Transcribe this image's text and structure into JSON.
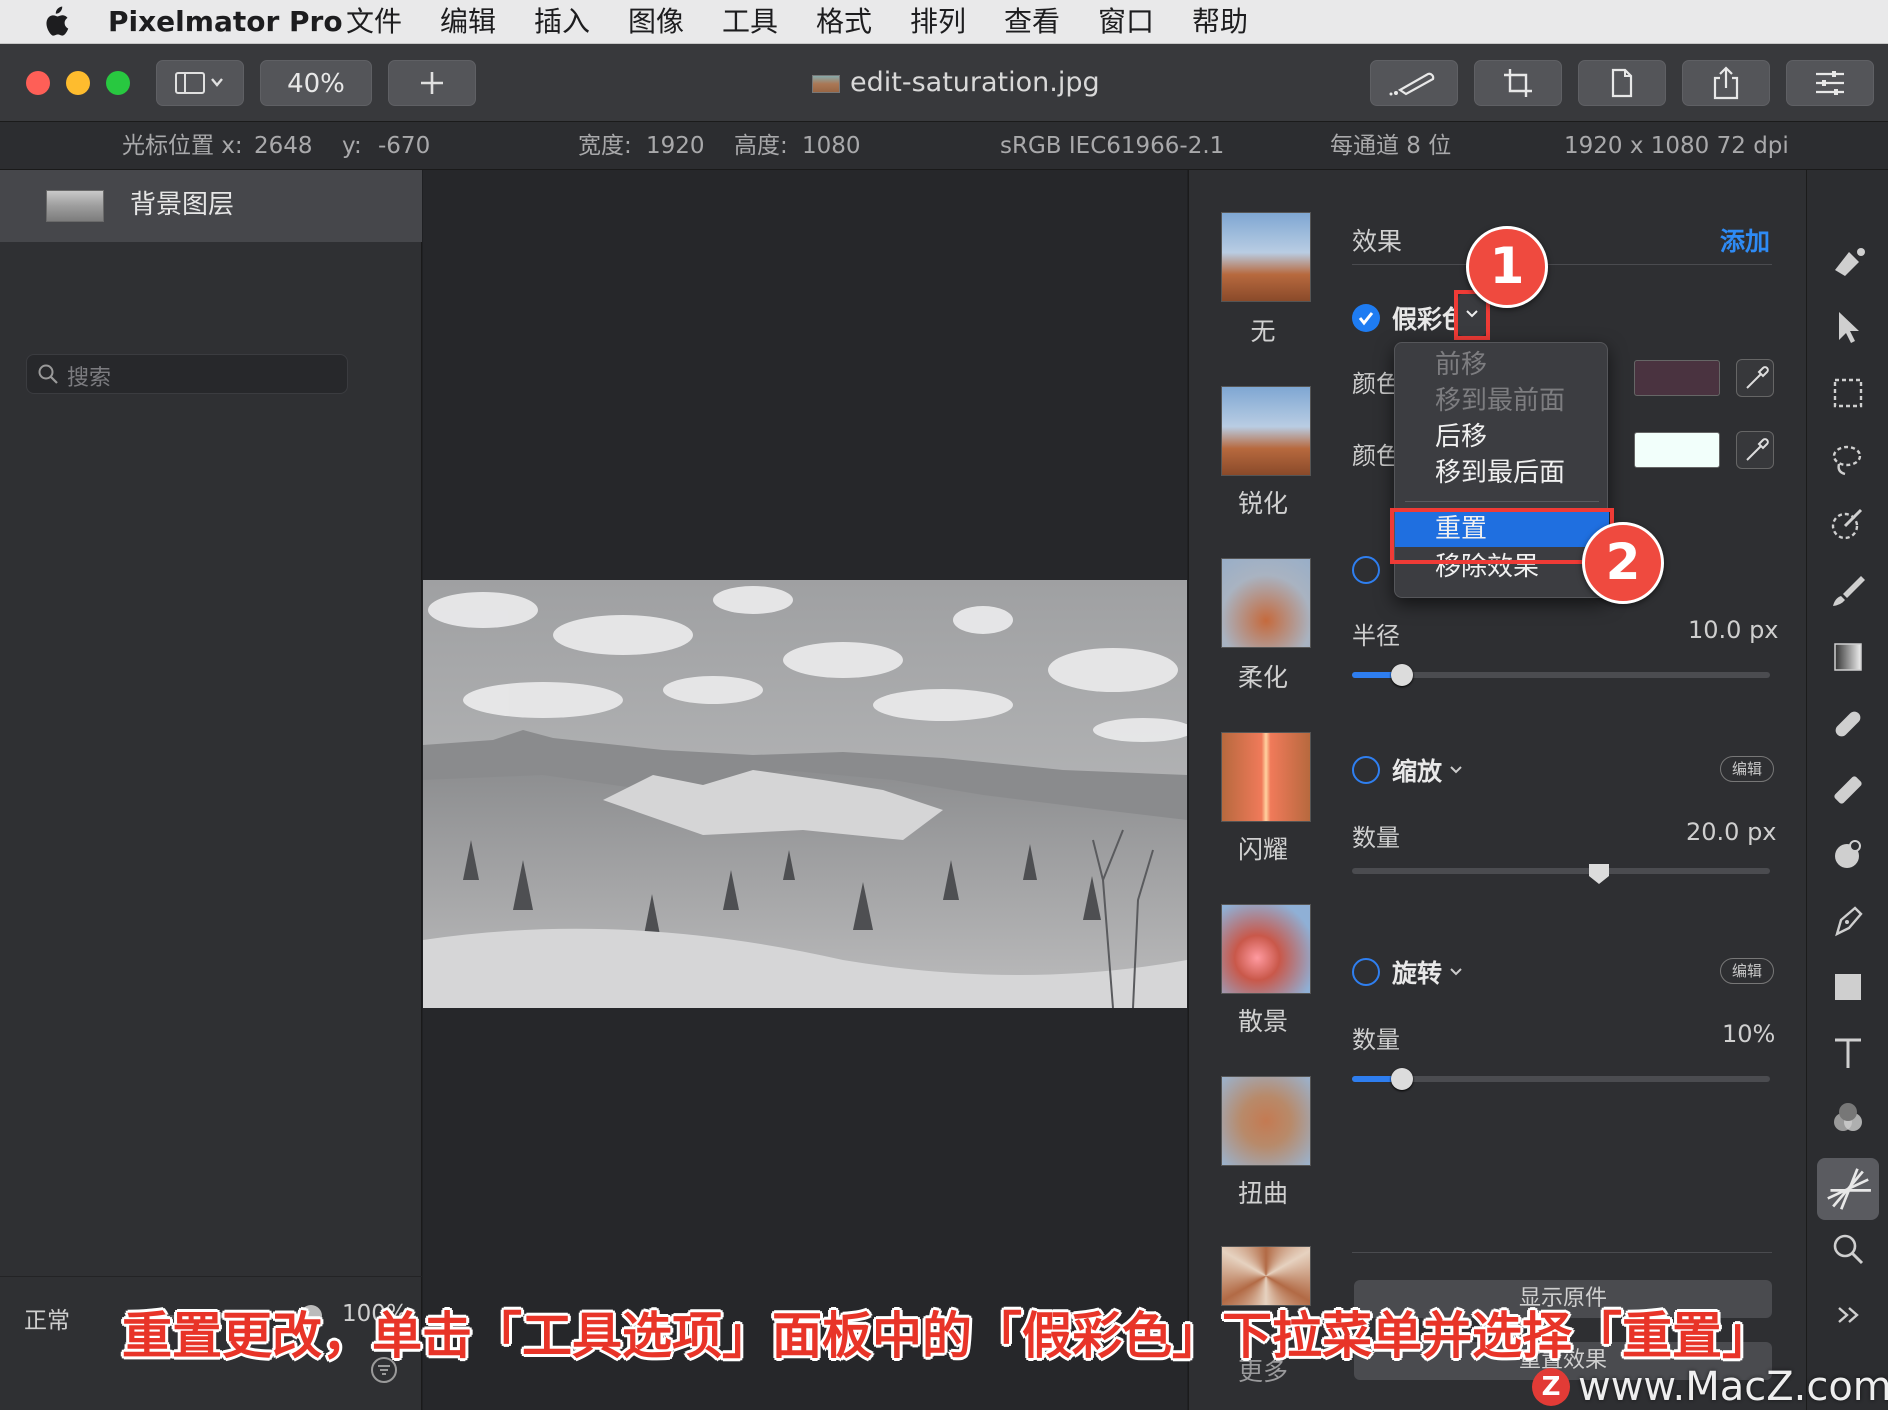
{
  "menubar": {
    "app_name": "Pixelmator Pro",
    "items": [
      "文件",
      "编辑",
      "插入",
      "图像",
      "工具",
      "格式",
      "排列",
      "查看",
      "窗口",
      "帮助"
    ]
  },
  "toolbar": {
    "zoom": "40%",
    "document_title": "edit-saturation.jpg"
  },
  "infobar": {
    "cursor_x_label": "光标位置 x:",
    "cursor_x": "2648",
    "cursor_y_label": "y:",
    "cursor_y": "-670",
    "width_label": "宽度:",
    "width": "1920",
    "height_label": "高度:",
    "height": "1080",
    "color_profile": "sRGB IEC61966-2.1",
    "bit_depth": "每通道 8 位",
    "resolution": "1920 x 1080 72 dpi"
  },
  "layers": {
    "items": [
      {
        "name": "背景图层"
      }
    ],
    "blend_mode": "正常",
    "opacity": "100%",
    "search_placeholder": "搜索"
  },
  "effects_browser": {
    "items": [
      "无",
      "锐化",
      "柔化",
      "闪耀",
      "散景",
      "扭曲"
    ]
  },
  "options": {
    "header": "效果",
    "add_label": "添加",
    "false_color": {
      "title": "假彩色",
      "row1_label": "颜色",
      "row2_label": "颜色",
      "color1": "#4a3340",
      "color2": "#f2fffb"
    },
    "blur": {
      "radius_label": "半径",
      "radius_value": "10.0 px",
      "radius_fraction": 0.12
    },
    "zoom_effect": {
      "title": "缩放",
      "edit": "编辑",
      "amount_label": "数量",
      "amount_value": "20.0 px",
      "amount_fraction": 0.59
    },
    "spin": {
      "title": "旋转",
      "edit": "编辑",
      "amount_label": "数量",
      "amount_value": "10%",
      "amount_fraction": 0.12
    },
    "show_original": "显示原件",
    "bottom_partial": "更多",
    "reset_partial": "重置效果"
  },
  "dropdown": {
    "items": [
      {
        "label": "前移",
        "enabled": false
      },
      {
        "label": "移到最前面",
        "enabled": false
      },
      {
        "label": "后移",
        "enabled": true
      },
      {
        "label": "移到最后面",
        "enabled": true
      },
      {
        "label": "重置",
        "enabled": true,
        "highlighted": true
      },
      {
        "label": "移除效果",
        "enabled": true
      }
    ]
  },
  "annotations": {
    "badge1": "1",
    "badge2": "2",
    "caption": "重置更改，单击「工具选项」面板中的「假彩色」下拉菜单并选择「重置」",
    "watermark": "www.MacZ.com",
    "watermark_logo": "Z"
  },
  "colors": {
    "accent": "#1e7cf2",
    "annotation_red": "#ef3b36",
    "panel_bg": "#2e2f32"
  }
}
